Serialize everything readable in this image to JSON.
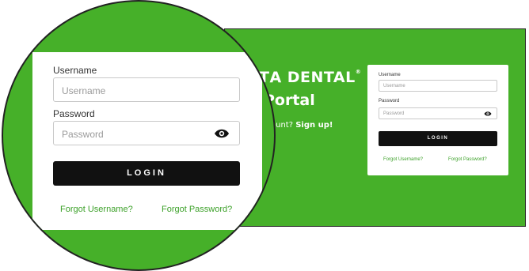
{
  "background": {
    "brand_text": "ΤΑ DENTAL",
    "portal_title": "Portal",
    "signup_prefix": "ccount?",
    "signup_link": "Sign up!"
  },
  "login_small": {
    "username_label": "Username",
    "username_placeholder": "Username",
    "password_label": "Password",
    "password_placeholder": "Password",
    "login_button": "LOGIN",
    "forgot_username": "Forgot Username?",
    "forgot_password": "Forgot Password?"
  },
  "login_zoomed": {
    "username_label": "Username",
    "username_placeholder": "Username",
    "password_label": "Password",
    "password_placeholder": "Password",
    "login_button": "LOGIN",
    "forgot_username": "Forgot Username?",
    "forgot_password": "Forgot Password?"
  },
  "colors": {
    "brand_green": "#46b029",
    "link_green": "#3da12a",
    "button_black": "#111111"
  },
  "icons": {
    "password_toggle": "eye-icon"
  }
}
